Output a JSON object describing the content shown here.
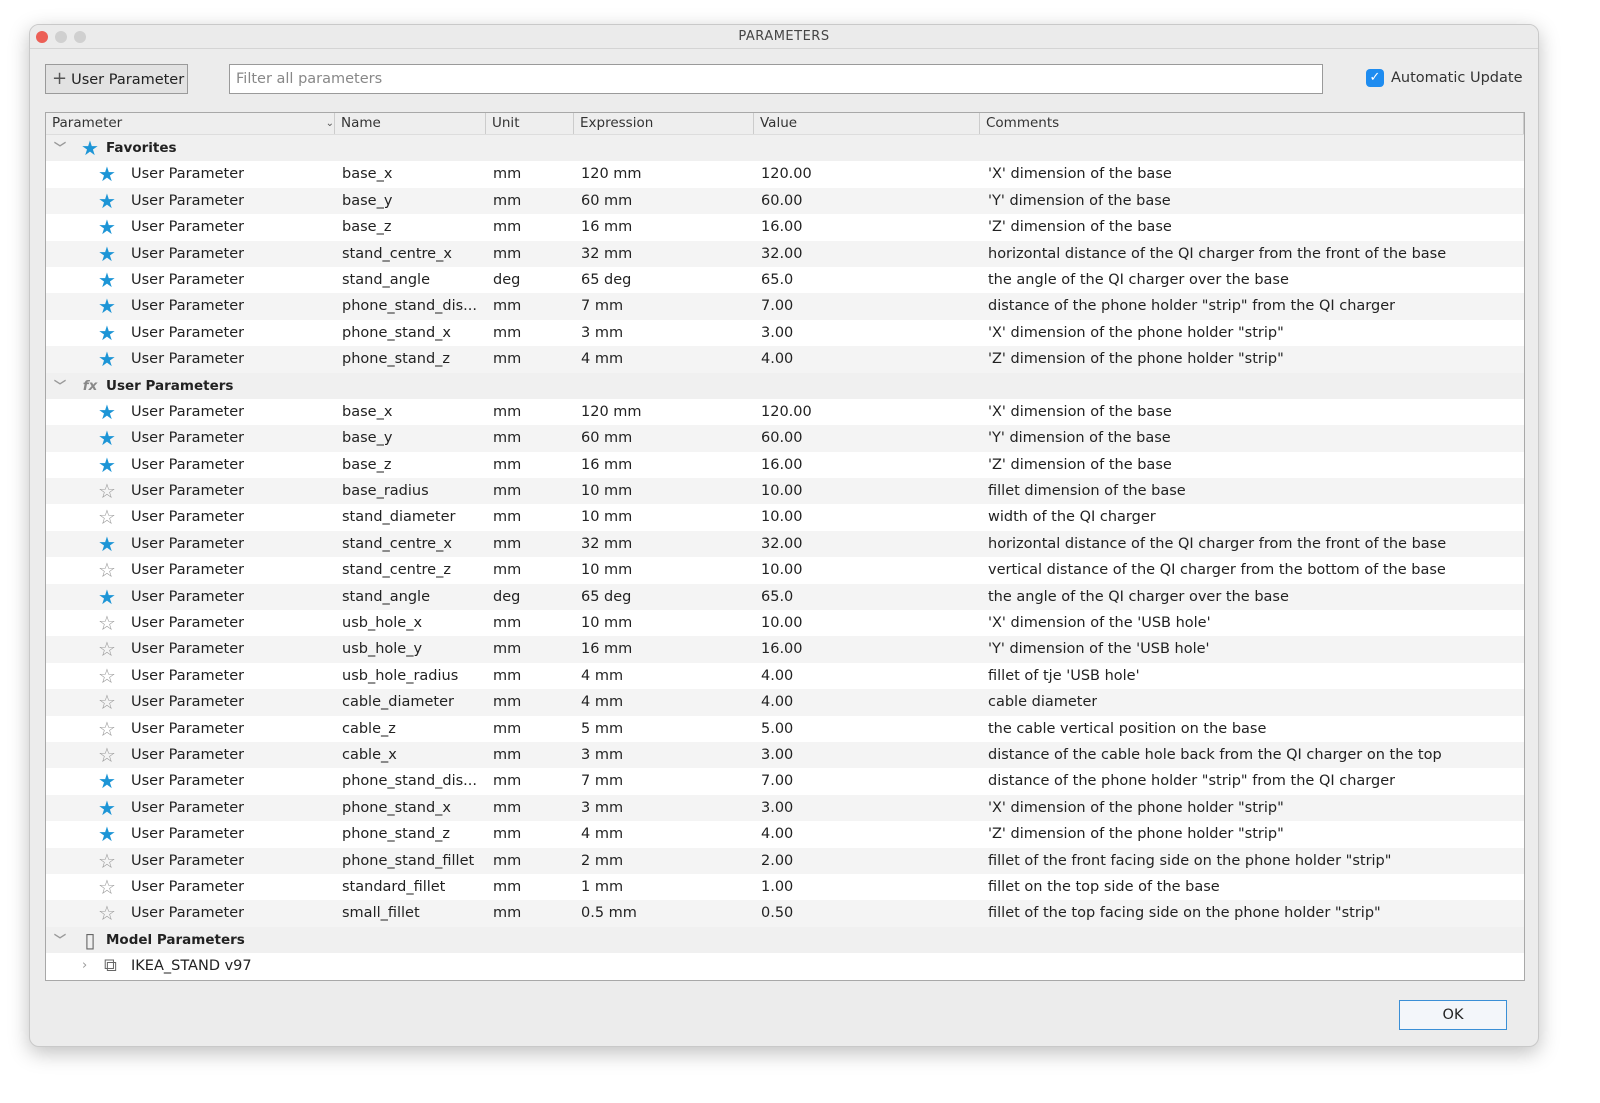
{
  "window": {
    "title": "PARAMETERS"
  },
  "toolbar": {
    "add_label": "User Parameter",
    "filter_placeholder": "Filter all parameters",
    "auto_update_label": "Automatic Update",
    "auto_update_checked": true
  },
  "columns": [
    "Parameter",
    "Name",
    "Unit",
    "Expression",
    "Value",
    "Comments"
  ],
  "groups": {
    "favorites": "Favorites",
    "user": "User Parameters",
    "model": "Model Parameters",
    "model_child": "IKEA_STAND v97"
  },
  "favorites": [
    {
      "fav": true,
      "type": "User Parameter",
      "name": "base_x",
      "unit": "mm",
      "expr": "120 mm",
      "value": "120.00",
      "comment": "'X' dimension of the base"
    },
    {
      "fav": true,
      "type": "User Parameter",
      "name": "base_y",
      "unit": "mm",
      "expr": "60 mm",
      "value": "60.00",
      "comment": "'Y' dimension of the base"
    },
    {
      "fav": true,
      "type": "User Parameter",
      "name": "base_z",
      "unit": "mm",
      "expr": "16 mm",
      "value": "16.00",
      "comment": "'Z' dimension of the base"
    },
    {
      "fav": true,
      "type": "User Parameter",
      "name": "stand_centre_x",
      "unit": "mm",
      "expr": "32 mm",
      "value": "32.00",
      "comment": "horizontal distance of the QI charger from the front of the base"
    },
    {
      "fav": true,
      "type": "User Parameter",
      "name": "stand_angle",
      "unit": "deg",
      "expr": "65 deg",
      "value": "65.0",
      "comment": "the angle of the QI charger over the base"
    },
    {
      "fav": true,
      "type": "User Parameter",
      "name": "phone_stand_dis...",
      "unit": "mm",
      "expr": "7 mm",
      "value": "7.00",
      "comment": "distance of the phone holder \"strip\" from the QI charger"
    },
    {
      "fav": true,
      "type": "User Parameter",
      "name": "phone_stand_x",
      "unit": "mm",
      "expr": "3 mm",
      "value": "3.00",
      "comment": "'X' dimension of the phone holder \"strip\""
    },
    {
      "fav": true,
      "type": "User Parameter",
      "name": "phone_stand_z",
      "unit": "mm",
      "expr": "4 mm",
      "value": "4.00",
      "comment": "'Z' dimension of the phone holder \"strip\""
    }
  ],
  "user_params": [
    {
      "fav": true,
      "type": "User Parameter",
      "name": "base_x",
      "unit": "mm",
      "expr": "120 mm",
      "value": "120.00",
      "comment": "'X' dimension of the base"
    },
    {
      "fav": true,
      "type": "User Parameter",
      "name": "base_y",
      "unit": "mm",
      "expr": "60 mm",
      "value": "60.00",
      "comment": "'Y' dimension of the base"
    },
    {
      "fav": true,
      "type": "User Parameter",
      "name": "base_z",
      "unit": "mm",
      "expr": "16 mm",
      "value": "16.00",
      "comment": "'Z' dimension of the base"
    },
    {
      "fav": false,
      "type": "User Parameter",
      "name": "base_radius",
      "unit": "mm",
      "expr": "10 mm",
      "value": "10.00",
      "comment": "fillet dimension of the base"
    },
    {
      "fav": false,
      "type": "User Parameter",
      "name": "stand_diameter",
      "unit": "mm",
      "expr": "10 mm",
      "value": "10.00",
      "comment": "width of the QI charger"
    },
    {
      "fav": true,
      "type": "User Parameter",
      "name": "stand_centre_x",
      "unit": "mm",
      "expr": "32 mm",
      "value": "32.00",
      "comment": "horizontal distance of the QI charger from the front of the base"
    },
    {
      "fav": false,
      "type": "User Parameter",
      "name": "stand_centre_z",
      "unit": "mm",
      "expr": "10 mm",
      "value": "10.00",
      "comment": "vertical distance of the QI charger from the bottom of the base"
    },
    {
      "fav": true,
      "type": "User Parameter",
      "name": "stand_angle",
      "unit": "deg",
      "expr": "65 deg",
      "value": "65.0",
      "comment": "the angle of the QI charger over the base"
    },
    {
      "fav": false,
      "type": "User Parameter",
      "name": "usb_hole_x",
      "unit": "mm",
      "expr": "10 mm",
      "value": "10.00",
      "comment": "'X' dimension of the 'USB hole'"
    },
    {
      "fav": false,
      "type": "User Parameter",
      "name": "usb_hole_y",
      "unit": "mm",
      "expr": "16 mm",
      "value": "16.00",
      "comment": "'Y' dimension of the 'USB hole'"
    },
    {
      "fav": false,
      "type": "User Parameter",
      "name": "usb_hole_radius",
      "unit": "mm",
      "expr": "4 mm",
      "value": "4.00",
      "comment": "fillet of tje 'USB hole'"
    },
    {
      "fav": false,
      "type": "User Parameter",
      "name": "cable_diameter",
      "unit": "mm",
      "expr": "4 mm",
      "value": "4.00",
      "comment": "cable diameter"
    },
    {
      "fav": false,
      "type": "User Parameter",
      "name": "cable_z",
      "unit": "mm",
      "expr": "5 mm",
      "value": "5.00",
      "comment": "the cable vertical position on the base"
    },
    {
      "fav": false,
      "type": "User Parameter",
      "name": "cable_x",
      "unit": "mm",
      "expr": "3 mm",
      "value": "3.00",
      "comment": "distance of the cable hole back from the QI charger on the top"
    },
    {
      "fav": true,
      "type": "User Parameter",
      "name": "phone_stand_dis...",
      "unit": "mm",
      "expr": "7 mm",
      "value": "7.00",
      "comment": "distance of the phone holder \"strip\" from the QI charger"
    },
    {
      "fav": true,
      "type": "User Parameter",
      "name": "phone_stand_x",
      "unit": "mm",
      "expr": "3 mm",
      "value": "3.00",
      "comment": "'X' dimension of the phone holder \"strip\""
    },
    {
      "fav": true,
      "type": "User Parameter",
      "name": "phone_stand_z",
      "unit": "mm",
      "expr": "4 mm",
      "value": "4.00",
      "comment": "'Z' dimension of the phone holder \"strip\""
    },
    {
      "fav": false,
      "type": "User Parameter",
      "name": "phone_stand_fillet",
      "unit": "mm",
      "expr": "2 mm",
      "value": "2.00",
      "comment": "fillet of the front facing side on the phone holder \"strip\""
    },
    {
      "fav": false,
      "type": "User Parameter",
      "name": "standard_fillet",
      "unit": "mm",
      "expr": "1 mm",
      "value": "1.00",
      "comment": "fillet on the top side of the base"
    },
    {
      "fav": false,
      "type": "User Parameter",
      "name": "small_fillet",
      "unit": "mm",
      "expr": "0.5 mm",
      "value": "0.50",
      "comment": "fillet of the top facing side on the phone holder \"strip\""
    }
  ],
  "footer": {
    "ok_label": "OK"
  },
  "colors": {
    "accent": "#1d95d6",
    "checkbox": "#1e8cf0"
  }
}
